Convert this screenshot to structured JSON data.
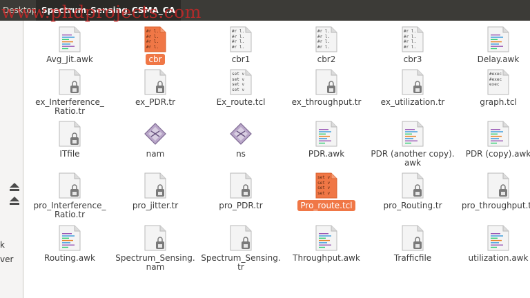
{
  "pathbar": {
    "home_label": "Desktop",
    "current_label": "Spectrum_Sensing_CSMA_CA"
  },
  "watermark": "www.phdprojects.com",
  "sidebar": {
    "text_1": "k",
    "text_2": "ver"
  },
  "colors": {
    "selection": "#f07746",
    "pathbar": "#3c3b37"
  },
  "files": [
    {
      "label": "Avg_Jit.awk",
      "icon": "awk-icon",
      "selected": false
    },
    {
      "label": "cbr",
      "icon": "text-preview-icon",
      "selected": true,
      "preview": [
        "#r l.",
        "#r l.",
        "#r l.",
        "#r l."
      ]
    },
    {
      "label": "cbr1",
      "icon": "text-preview-icon",
      "selected": false,
      "preview": [
        "#r l.",
        "#r l.",
        "#r l.",
        "#r l."
      ]
    },
    {
      "label": "cbr2",
      "icon": "text-preview-icon",
      "selected": false,
      "preview": [
        "#r l.",
        "#r l.",
        "#r l.",
        "#r l."
      ]
    },
    {
      "label": "cbr3",
      "icon": "text-preview-icon",
      "selected": false,
      "preview": [
        "#r l.",
        "#r l.",
        "#r l.",
        "#r l."
      ]
    },
    {
      "label": "Delay.awk",
      "icon": "awk-icon",
      "selected": false
    },
    {
      "label": "ex_Interference_ Ratio.tr",
      "icon": "locked-file-icon",
      "selected": false
    },
    {
      "label": "ex_PDR.tr",
      "icon": "locked-file-icon",
      "selected": false
    },
    {
      "label": "Ex_route.tcl",
      "icon": "text-preview-icon",
      "selected": false,
      "preview": [
        "set v",
        "set v",
        "set v",
        "set v"
      ]
    },
    {
      "label": "ex_throughput.tr",
      "icon": "locked-file-icon",
      "selected": false
    },
    {
      "label": "ex_utilization.tr",
      "icon": "locked-file-icon",
      "selected": false
    },
    {
      "label": "graph.tcl",
      "icon": "text-preview-icon",
      "selected": false,
      "preview": [
        "#exec",
        "#exec",
        "exec"
      ]
    },
    {
      "label": "ITfile",
      "icon": "locked-file-icon",
      "selected": false
    },
    {
      "label": "nam",
      "icon": "executable-icon",
      "selected": false
    },
    {
      "label": "ns",
      "icon": "executable-icon",
      "selected": false
    },
    {
      "label": "PDR.awk",
      "icon": "awk-icon",
      "selected": false
    },
    {
      "label": "PDR (another copy). awk",
      "icon": "awk-icon",
      "selected": false
    },
    {
      "label": "PDR (copy).awk",
      "icon": "awk-icon",
      "selected": false
    },
    {
      "label": "pro_Interference_ Ratio.tr",
      "icon": "locked-file-icon",
      "selected": false
    },
    {
      "label": "pro_jitter.tr",
      "icon": "locked-file-icon",
      "selected": false
    },
    {
      "label": "pro_PDR.tr",
      "icon": "locked-file-icon",
      "selected": false
    },
    {
      "label": "Pro_route.tcl",
      "icon": "text-preview-icon",
      "selected": true,
      "preview": [
        "set v",
        "set v",
        "set v",
        "set v"
      ]
    },
    {
      "label": "pro_Routing.tr",
      "icon": "locked-file-icon",
      "selected": false
    },
    {
      "label": "pro_throughput.tr",
      "icon": "locked-file-icon",
      "selected": false
    },
    {
      "label": "Routing.awk",
      "icon": "awk-icon",
      "selected": false
    },
    {
      "label": "Spectrum_Sensing. nam",
      "icon": "locked-file-icon",
      "selected": false
    },
    {
      "label": "Spectrum_Sensing. tr",
      "icon": "locked-file-icon",
      "selected": false
    },
    {
      "label": "Throughput.awk",
      "icon": "awk-icon",
      "selected": false
    },
    {
      "label": "Trafficfile",
      "icon": "locked-file-icon",
      "selected": false
    },
    {
      "label": "utilization.awk",
      "icon": "awk-icon",
      "selected": false
    }
  ]
}
